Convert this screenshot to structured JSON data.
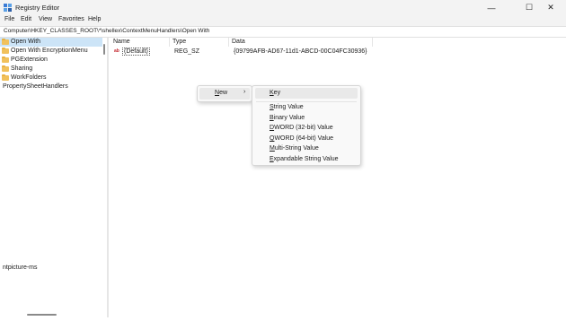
{
  "window": {
    "title": "Registry Editor",
    "controls": {
      "minimize": "—",
      "maximize": "☐",
      "close": "✕"
    }
  },
  "menubar": {
    "items": [
      "File",
      "Edit",
      "View",
      "Favorites",
      "Help"
    ]
  },
  "address": {
    "path": "Computer\\HKEY_CLASSES_ROOT\\*\\shellex\\ContextMenuHandlers\\Open With"
  },
  "tree": {
    "items": [
      {
        "label": "Open With",
        "folder": true,
        "selected": true
      },
      {
        "label": "Open With EncryptionMenu",
        "folder": true
      },
      {
        "label": "PGExtension",
        "folder": true
      },
      {
        "label": "Sharing",
        "folder": true
      },
      {
        "label": "WorkFolders",
        "folder": true
      },
      {
        "label": "PropertySheetHandlers",
        "folder": false
      }
    ],
    "lower_label": "ntpicture-ms"
  },
  "list": {
    "columns": [
      "Name",
      "Type",
      "Data"
    ],
    "rows": [
      {
        "icon": "ab",
        "name": "(Default)",
        "type": "REG_SZ",
        "data": "{09799AFB-AD67-11d1-ABCD-00C04FC30936}"
      }
    ]
  },
  "context_menu": {
    "new_item": {
      "label": "New",
      "accel": "N",
      "rest": "ew"
    },
    "arrow": "›",
    "submenu": [
      {
        "accel": "K",
        "rest": "ey"
      },
      {
        "accel": "S",
        "rest": "tring Value"
      },
      {
        "accel": "B",
        "rest": "inary Value"
      },
      {
        "accel": "D",
        "rest": "WORD (32-bit) Value"
      },
      {
        "accel": "Q",
        "rest": "WORD (64-bit) Value"
      },
      {
        "accel": "M",
        "rest": "ulti-String Value"
      },
      {
        "accel": "E",
        "rest": "xpandable String Value"
      }
    ]
  },
  "colors": {
    "selection": "#cce4f7",
    "folder": "#f1c15c",
    "menu_hover": "#e9e9e9",
    "string_icon": "#c4262e"
  }
}
